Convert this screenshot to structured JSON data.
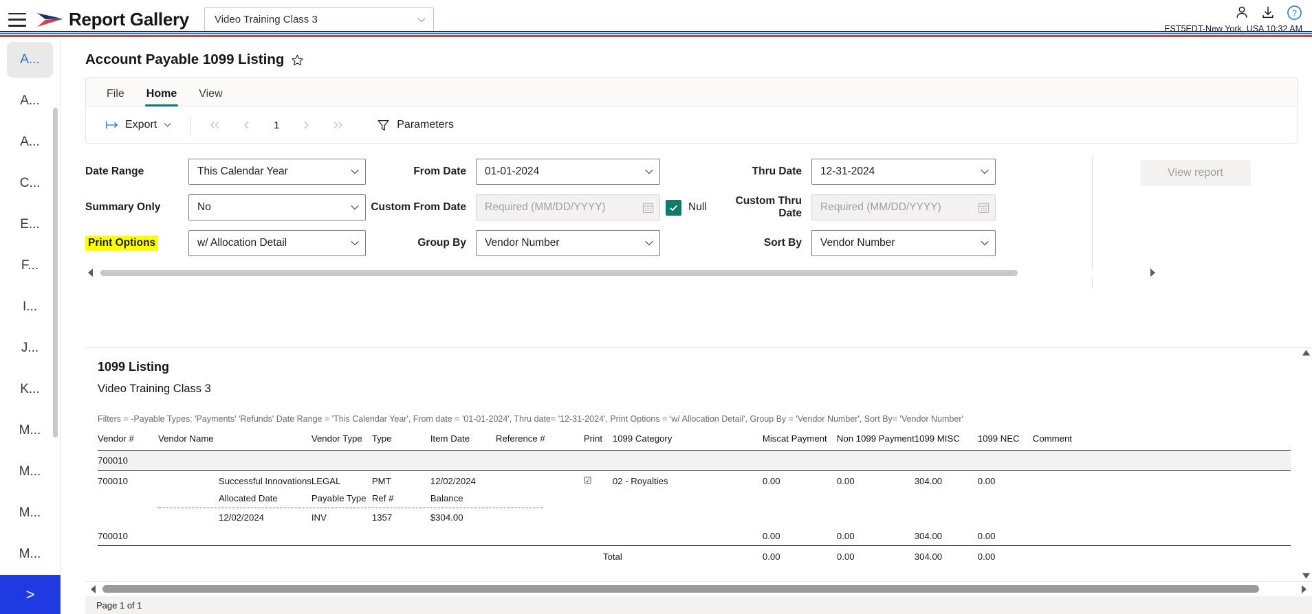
{
  "topbar": {
    "menu_icon": "hamburger-menu-icon",
    "brand": "Report Gallery",
    "context_select": {
      "value": "Video Training Class 3"
    },
    "icons": [
      "user-icon",
      "download-icon",
      "help-icon"
    ],
    "timezone": "EST5EDT-New York, USA 10:32 AM"
  },
  "rail": {
    "items": [
      {
        "label": "A...",
        "active": true
      },
      {
        "label": "A...",
        "active": false
      },
      {
        "label": "A...",
        "active": false
      },
      {
        "label": "C...",
        "active": false
      },
      {
        "label": "E...",
        "active": false
      },
      {
        "label": "F...",
        "active": false
      },
      {
        "label": "I...",
        "active": false
      },
      {
        "label": "J...",
        "active": false
      },
      {
        "label": "K...",
        "active": false
      },
      {
        "label": "M...",
        "active": false
      },
      {
        "label": "M...",
        "active": false
      },
      {
        "label": "M...",
        "active": false
      },
      {
        "label": "M...",
        "active": false
      }
    ],
    "expand_label": ">"
  },
  "page": {
    "title": "Account Payable 1099 Listing",
    "favorite_icon": "star-icon"
  },
  "ribbon": {
    "tabs": [
      {
        "label": "File",
        "active": false
      },
      {
        "label": "Home",
        "active": true
      },
      {
        "label": "View",
        "active": false
      }
    ],
    "export_label": "Export",
    "page_number": "1",
    "parameters_label": "Parameters"
  },
  "params": {
    "date_range": {
      "label": "Date Range",
      "value": "This Calendar Year"
    },
    "summary_only": {
      "label": "Summary Only",
      "value": "No"
    },
    "print_options": {
      "label": "Print Options",
      "value": "w/ Allocation Detail",
      "highlight": "#ffff00"
    },
    "from_date": {
      "label": "From Date",
      "value": "01-01-2024"
    },
    "custom_from_date": {
      "label": "Custom From Date",
      "placeholder": "Required (MM/DD/YYYY)"
    },
    "group_by": {
      "label": "Group By",
      "value": "Vendor Number"
    },
    "null_checkbox": {
      "label": "Null",
      "checked": true,
      "color": "#107c67"
    },
    "thru_date": {
      "label": "Thru Date",
      "value": "12-31-2024"
    },
    "custom_thru_date": {
      "label": "Custom Thru Date",
      "placeholder": "Required (MM/DD/YYYY)"
    },
    "sort_by": {
      "label": "Sort By",
      "value": "Vendor Number"
    },
    "view_report_label": "View report"
  },
  "report": {
    "title": "1099 Listing",
    "subtitle": "Video Training Class 3",
    "filters": "Filters = -Payable Types: 'Payments' 'Refunds'  Date Range = 'This Calendar Year', From date = '01-01-2024', Thru date= '12-31-2024', Print Options = 'w/ Allocation Detail', Group By = 'Vendor Number', Sort By= 'Vendor Number'",
    "columns": [
      "Vendor #",
      "Vendor Name",
      "Vendor Type",
      "Type",
      "Item Date",
      "Reference #",
      "Print",
      "1099 Category",
      "Miscat Payment",
      "Non 1099 Payment",
      "1099 MISC",
      "1099 NEC",
      "Comment"
    ],
    "group_header": "700010",
    "detail_row": {
      "vendor_number": "700010",
      "vendor_name": "Successful Innovations",
      "vendor_type": "LEGAL",
      "type": "PMT",
      "item_date": "12/02/2024",
      "reference": "",
      "print": "☑",
      "category": "02 - Royalties",
      "miscat_payment": "0.00",
      "non_1099_payment": "0.00",
      "misc_1099": "304.00",
      "nec_1099": "0.00",
      "comment": ""
    },
    "alloc_headers": {
      "allocated_date": "Allocated Date",
      "payable_type": "Payable Type",
      "ref": "Ref #",
      "balance": "Balance"
    },
    "alloc_row": {
      "allocated_date": "12/02/2024",
      "payable_type": "INV",
      "ref": "1357",
      "balance": "$304.00"
    },
    "group_total": {
      "label": "700010",
      "miscat_payment": "0.00",
      "non_1099_payment": "0.00",
      "misc_1099": "304.00",
      "nec_1099": "0.00"
    },
    "total": {
      "label": "Total",
      "miscat_payment": "0.00",
      "non_1099_payment": "0.00",
      "misc_1099": "304.00",
      "nec_1099": "0.00"
    },
    "status": "Page 1 of 1"
  }
}
